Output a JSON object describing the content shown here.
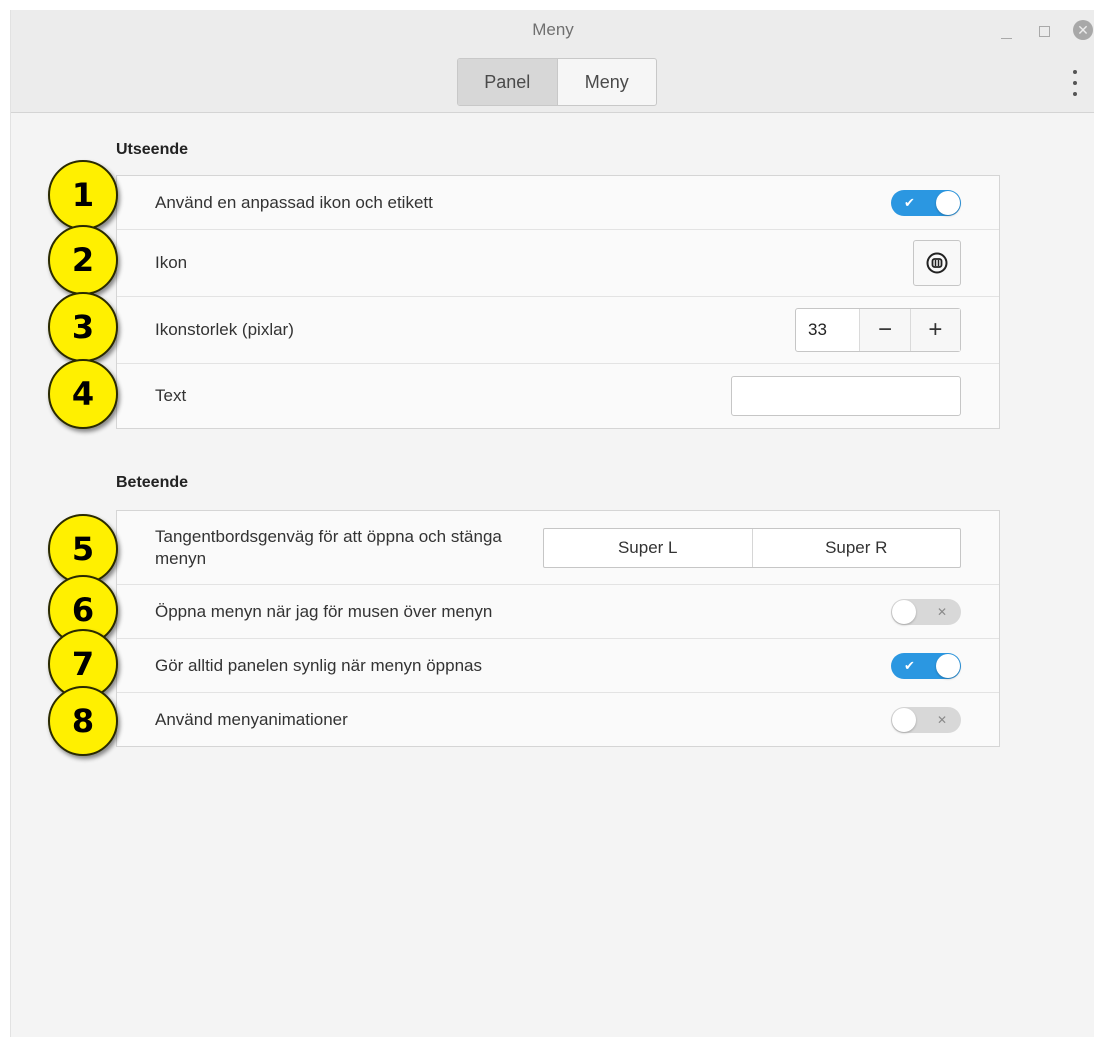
{
  "window": {
    "title": "Meny"
  },
  "header": {
    "tabs": [
      {
        "label": "Panel",
        "active": true
      },
      {
        "label": "Meny",
        "active": false
      }
    ]
  },
  "appearance": {
    "title": "Utseende",
    "custom_icon_label": "Använd en anpassad ikon och etikett",
    "custom_icon_enabled": true,
    "icon_label": "Ikon",
    "icon_size_label": "Ikonstorlek (pixlar)",
    "icon_size_value": "33",
    "text_label": "Text",
    "text_value": ""
  },
  "behavior": {
    "title": "Beteende",
    "shortcut_label": "Tangentbordsgenväg för att öppna och stänga menyn",
    "shortcut_keys": [
      "Super L",
      "Super R"
    ],
    "hover_label": "Öppna menyn när jag för musen över menyn",
    "hover_enabled": false,
    "panel_visible_label": "Gör alltid panelen synlig när menyn öppnas",
    "panel_visible_enabled": true,
    "animations_label": "Använd menyanimationer",
    "animations_enabled": false
  },
  "callouts": [
    "1",
    "2",
    "3",
    "4",
    "5",
    "6",
    "7",
    "8"
  ],
  "colors": {
    "accent": "#2b97e1",
    "callout": "#fff000"
  }
}
